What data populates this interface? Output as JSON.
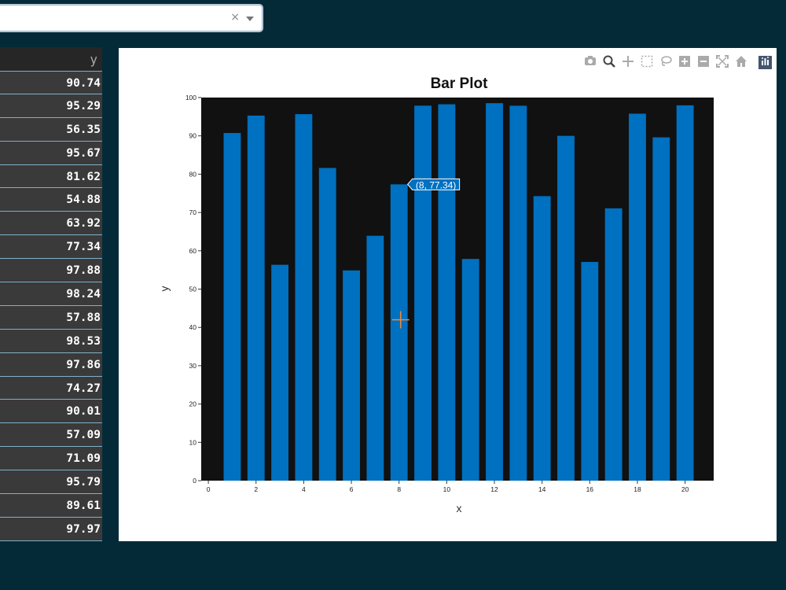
{
  "dropdown": {
    "clear_symbol": "×"
  },
  "table": {
    "header": "y",
    "rows": [
      "90.74",
      "95.29",
      "56.35",
      "95.67",
      "81.62",
      "54.88",
      "63.92",
      "77.34",
      "97.88",
      "98.24",
      "57.88",
      "98.53",
      "97.86",
      "74.27",
      "90.01",
      "57.09",
      "71.09",
      "95.79",
      "89.61",
      "97.97"
    ]
  },
  "modebar": {
    "icons": [
      "camera-icon",
      "zoom-icon",
      "pan-icon",
      "box-select-icon",
      "lasso-icon",
      "zoom-in-icon",
      "zoom-out-icon",
      "autoscale-icon",
      "reset-axes-icon"
    ],
    "logo": "plotly-logo-icon"
  },
  "chart_data": {
    "type": "bar",
    "title": "Bar Plot",
    "xlabel": "x",
    "ylabel": "y",
    "x": [
      1,
      2,
      3,
      4,
      5,
      6,
      7,
      8,
      9,
      10,
      11,
      12,
      13,
      14,
      15,
      16,
      17,
      18,
      19,
      20
    ],
    "values": [
      90.74,
      95.29,
      56.35,
      95.67,
      81.62,
      54.88,
      63.92,
      77.34,
      97.88,
      98.24,
      57.88,
      98.53,
      97.86,
      74.27,
      90.01,
      57.09,
      71.09,
      95.79,
      89.61,
      97.97
    ],
    "xlim": [
      -0.3,
      21.2
    ],
    "ylim": [
      0,
      100
    ],
    "xticks": [
      0,
      2,
      4,
      6,
      8,
      10,
      12,
      14,
      16,
      18,
      20
    ],
    "yticks": [
      0,
      10,
      20,
      30,
      40,
      50,
      60,
      70,
      80,
      90,
      100
    ],
    "bar_color": "#0070c0",
    "plot_bg": "#111111",
    "hover_label": "(8, 77.34)",
    "hover_x": 8,
    "hover_y": 77.34,
    "cursor_color": "#f08a3c"
  }
}
